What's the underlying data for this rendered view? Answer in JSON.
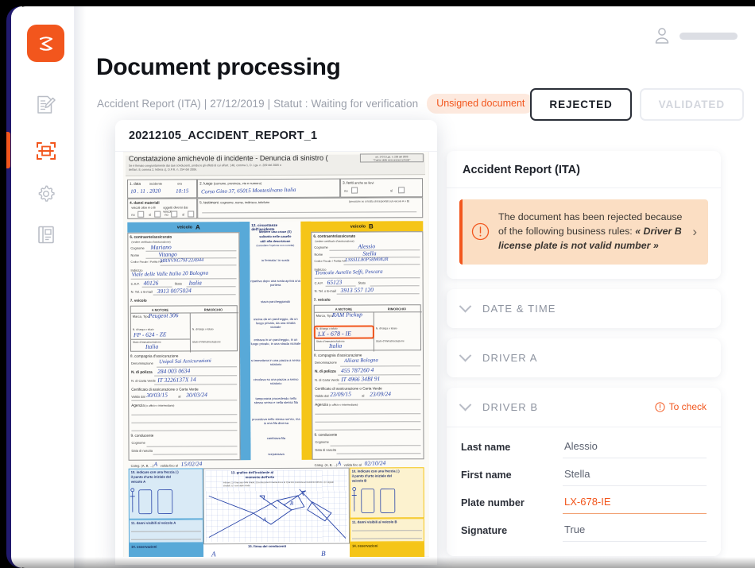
{
  "brand": {
    "logo_glyph": "Z",
    "accent_color": "#f2561d",
    "frame_color": "#211a6e"
  },
  "sidebar": {
    "items": [
      {
        "icon": "document-edit-icon",
        "active": false
      },
      {
        "icon": "scan-document-icon",
        "active": true
      },
      {
        "icon": "gear-icon",
        "active": false
      },
      {
        "icon": "manual-book-icon",
        "active": false
      }
    ]
  },
  "header": {
    "title": "Document processing",
    "subtitle": "Accident Report (ITA) | 27/12/2019 | Statut : Waiting for verification",
    "badge": "Unsigned document",
    "user_icon": "user-avatar-icon"
  },
  "actions": {
    "rejected_label": "REJECTED",
    "validated_label": "VALIDATED",
    "selected": "REJECTED"
  },
  "document_viewer": {
    "file_name": "20212105_ACCIDENT_REPORT_1",
    "scan": {
      "title": "Constatazione amichevole di incidente - Denuncia di sinistro",
      "title_paren_open": "(",
      "title_paren_close": ")",
      "art_note_line1": "art. 143 D.Lgs. n.  209 del 2005",
      "art_note_line2": "\"Codice delle assicurazioni private\"",
      "subtitle_line1": "Se è firmato congiuntamente dai due conducenti, produce gli effetti di cui all'art. 148, comma 1, D. Lgs. n. 209 del 2005 e",
      "subtitle_line2": "dell'art. 8, comma 2, lettera c), D.P.R. n. 254 del 2006.",
      "box1_label": "1. data",
      "box1_sub": "incidente",
      "box1_time_label": "ora",
      "box1_value": "10 . 11 . 2020",
      "box1_time_value": "10:15",
      "box2_label": "2. luogo",
      "box2_sub": "(comune, provincia, via e numero)",
      "box2_value": "Corso Gino 37, 65015 Montesilvano Italia",
      "box3_label": "3. feriti",
      "box3_sub": "anche se lievi",
      "box3_no": "no",
      "box3_si": "sì",
      "box4_label": "4. danni materiali",
      "box4_sub1": "veicoli oltre A o B",
      "box4_sub2": "oggetti diversi dai veicoli",
      "box4_no": "no",
      "box4_si": "sì",
      "box5_label": "5. testimoni:",
      "box5_sub": "cognome, nome, indirizzo, telefono",
      "box5_note": "(precisare se si tratta di trasportati sul veicolo A o B)",
      "vehicle_a_head": "veicolo",
      "vehicle_a_letter": "A",
      "vehicle_b_head": "veicolo",
      "vehicle_b_letter": "B",
      "box6_label": "6. contraente/assicurato",
      "box6_sub": "(vedere certificato d'assicurazione)",
      "box7_label": "7. veicolo",
      "box8_label": "8. compagnia d'assicurazione",
      "box8_sub": "(vedere certificato d'assicurazione)",
      "f_cognome": "Cognome",
      "f_cognome_sub": "(maiuscolo)",
      "f_nome": "Nome",
      "f_codfisc": "Codice Fiscale / Partita IVA",
      "f_indirizzo": "Indirizzo",
      "f_indirizzo_sub": "(comune, provincia, via e numero)",
      "f_cap": "C.A.P.",
      "f_stato": "Stato",
      "f_tel": "N. Tel. o E-mail",
      "f_motore": "A MOTORE",
      "f_rimorchio": "RIMORCHIO",
      "f_marca": "Marca, Tipo",
      "f_targa": "N. di targa o telaio",
      "f_targa_b": "N. di targa o telaio",
      "f_immatric": "Stato d'immatricolazione",
      "f_denominazione": "Denominazione",
      "f_polizza": "N. di polizza",
      "f_cartaverde": "N. di Carta Verde",
      "f_certificato": "Certificato di assicurazione",
      "f_ocartaverde": "o Carta Verde",
      "f_valido": "Valido dal",
      "f_al": "al",
      "f_agenzia": "Agenzia",
      "f_agenzia_sub": "(o ufficio o intermediario)",
      "box9_label": "9. conducente",
      "box9_sub": "(vedere patente di guida)",
      "f_datanascita": "Data di nascita",
      "f_patente": "Patente n.",
      "f_categoria": "Categ. (A, B, ...)",
      "f_valida": "valida fino al",
      "box12_label": "12. circostanze dell'incidente",
      "box12_instr1": "Mettere una croce (X)",
      "box12_instr2": "soltanto nelle caselle",
      "box12_instr3": "utili alla descrizione",
      "box12_instr4": "(cancellare l'opzione non corretta)",
      "box13_label": "13. grafico dell'incidente al",
      "box13_label2": "momento dell'urto",
      "box13_note": "indicare: 1) il tracciato delle strade; 2) la direzione di marcia di A e B; 3) la loro posizione al momento dell'urto; 4) i segnali stradali; 5) i nomi delle strade",
      "box10a_label1": "10. indicare con una freccia (  )",
      "box10a_label2": "il punto d'urto iniziale del",
      "box10a_label3": "veicolo A",
      "box10b_label3": "veicolo B",
      "box11a_label": "11. danni visibili al veicolo A",
      "box11b_label": "11. danni visibili al veicolo B",
      "box14_label": "14. osservazioni",
      "box15_label": "15. firma dei conducenti",
      "circumstances": [
        "in fermata / in sosta",
        "ripartiva dopo una sosta\napriva una portiera",
        "stava parcheggiando",
        "usciva da un parcheggio, da un\nluogo privato, da una strada vicinale",
        "entrava in un parcheggio, in un luogo\nprivato, in una strada vicinale",
        "si immetteva in una piazza\na senso rotatorio",
        "circolava su una piazza\na senso rotatorio",
        "tamponava procedendo nello\nstesso senso e nella stessa fila",
        "procedeva nello stesso senso,\nma in una fila diversa",
        "cambiava fila",
        "sorpassava"
      ],
      "vehicle_a": {
        "cognome": "Mariano",
        "nome": "Vitango",
        "codfisc": "MRNVNG79F22A944",
        "indirizzo": "Viale delle Valle Italia 20 Bologna",
        "cap": "40126",
        "stato": "Italia",
        "tel": "3913 0075024",
        "marca": "Peugeot 306",
        "targa": "FP - 624 - ZE",
        "immatricolazione": "Italia",
        "denominazione": "Unipol Sai Assicurazioni",
        "polizza": "284 003 0634",
        "cartaverde": "IT 3226137X 14",
        "valido_dal": "30/03/15",
        "valido_al": "30/03/24",
        "categoria": "A",
        "valida_fino": "15/02/24"
      },
      "vehicle_b": {
        "cognome": "Alessio",
        "nome": "Stella",
        "codfisc": "LSSSLL80P58M082R",
        "indirizzo": "Troncale Aurelio Seffi, Pescara",
        "cap": "65123",
        "tel": "3913 557 120",
        "marca": "RAM Pickup",
        "targa": "LX - 678 - IE",
        "immatricolazione": "Italia",
        "denominazione": "Allianz Bologna",
        "polizza": "455 787260 4",
        "cartaverde": "IT 4966 34BI 91",
        "valido_dal": "23/09/15",
        "valido_al": "23/09/24",
        "categoria": "A",
        "valida_fino": "02/10/24"
      },
      "highlighted_field": "vehicle_b.targa"
    }
  },
  "panel": {
    "report_title": "Accident Report (ITA)",
    "alert": {
      "icon": "alert-circle-icon",
      "text_plain": "The document has been rejected because of the following business rules: ",
      "text_emphasis": "« Driver B license plate is not valid number »",
      "chevron": "chevron-right-icon"
    },
    "sections": [
      {
        "label": "DATE & TIME",
        "flag": null,
        "expanded": false
      },
      {
        "label": "DRIVER A",
        "flag": null,
        "expanded": false
      },
      {
        "label": "DRIVER B",
        "flag": "To check",
        "expanded": true
      }
    ],
    "driver_b_fields": [
      {
        "label": "Last name",
        "value": "Alessio",
        "flagged": false
      },
      {
        "label": "First name",
        "value": "Stella",
        "flagged": false
      },
      {
        "label": "Plate number",
        "value": "LX-678-IE",
        "flagged": true
      },
      {
        "label": "Signature",
        "value": "True",
        "flagged": false
      }
    ]
  }
}
